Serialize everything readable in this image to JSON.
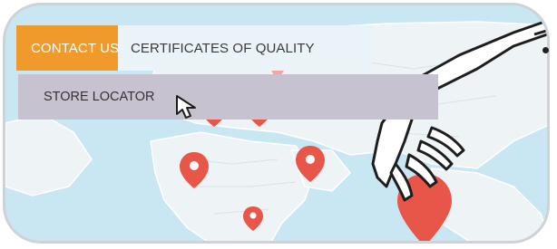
{
  "nav": {
    "tabs": [
      {
        "label": "CONTACT US",
        "active": true
      },
      {
        "label": "CERTIFICATES OF QUALITY",
        "active": false
      }
    ],
    "dropdown": {
      "items": [
        {
          "label": "STORE LOCATOR"
        }
      ]
    }
  },
  "colors": {
    "accent": "#f09a2b",
    "map_pin": "#e8564a",
    "ocean": "#c9e6f3",
    "land": "#eef3f5"
  },
  "icons": [
    "map-pin-icon",
    "mouse-cursor-icon",
    "hand-illustration"
  ]
}
